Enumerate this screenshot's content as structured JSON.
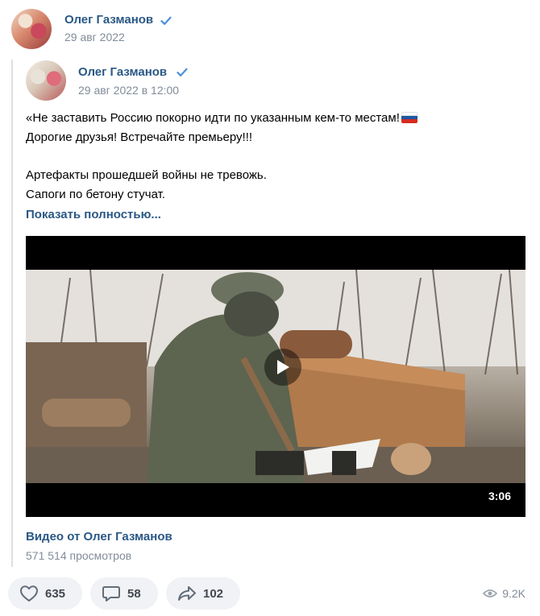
{
  "post": {
    "author": "Олег Газманов",
    "date": "29 авг 2022"
  },
  "repost": {
    "author": "Олег Газманов",
    "date": "29 авг 2022 в 12:00",
    "text_lines": [
      "«Не заставить Россию покорно идти по указанным кем-то местам!",
      "Дорогие друзья! Встречайте премьеру!!!",
      "Артефакты прошедшей войны не тревожь.",
      "Сапоги по бетону стучат."
    ],
    "show_more": "Показать полностью...",
    "flag_emoji": "russian-flag"
  },
  "video": {
    "duration": "3:06",
    "title": "Видео от Олег Газманов",
    "views": "571 514 просмотров"
  },
  "actions": {
    "likes": "635",
    "comments": "58",
    "shares": "102",
    "views": "9.2K"
  },
  "colors": {
    "link": "#2a5885",
    "muted": "#818c99",
    "pill_bg": "#f0f2f5"
  }
}
